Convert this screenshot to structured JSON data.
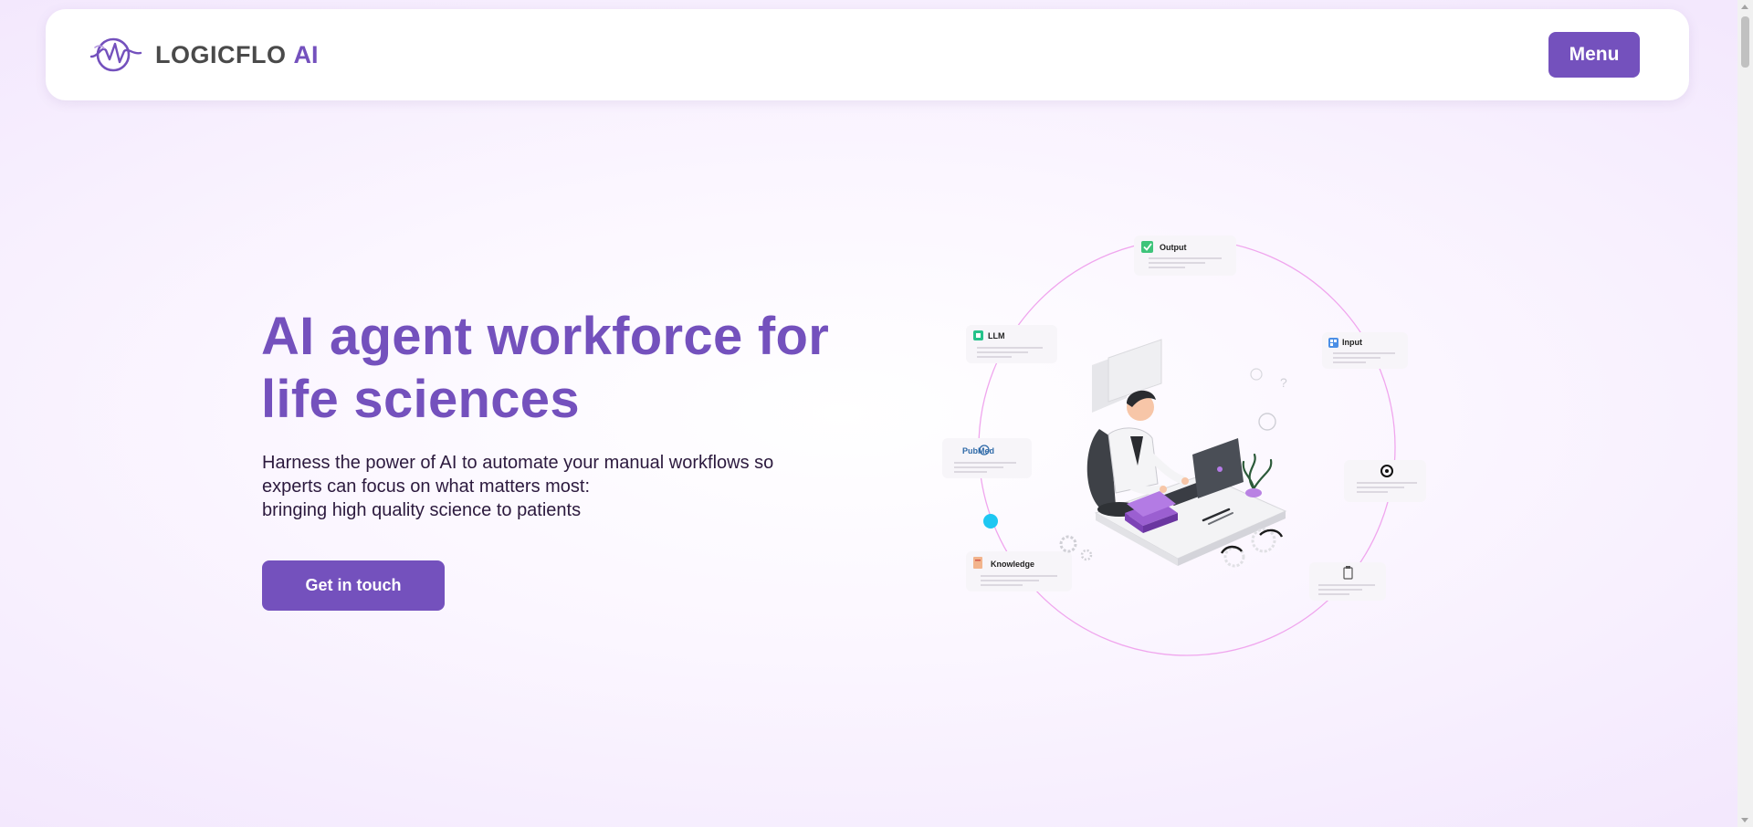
{
  "header": {
    "logo_text": "LOGICFLO",
    "logo_ai": "AI",
    "menu_label": "Menu"
  },
  "hero": {
    "title": "AI agent workforce for life sciences",
    "subtitle_lines": [
      "Harness the power of AI to automate your manual workflows so",
      "experts can focus on what matters most:",
      "bringing high quality science to patients"
    ],
    "cta_label": "Get in touch"
  },
  "illustration": {
    "cards": {
      "output": "Output",
      "llm": "LLM",
      "input": "Input",
      "pubmed": "PubMed",
      "knowledge": "Knowledge"
    },
    "icons": [
      "check-icon",
      "chip-icon",
      "grid-icon",
      "openai-icon",
      "document-icon",
      "clipboard-icon"
    ]
  },
  "colors": {
    "brand": "#7451bd",
    "logo_gray": "#4a4a4a",
    "text_dark": "#2c1a3e",
    "ring": "#f0a6ee",
    "dot": "#1ec7f2",
    "bg_tint": "#f3e8fd"
  }
}
